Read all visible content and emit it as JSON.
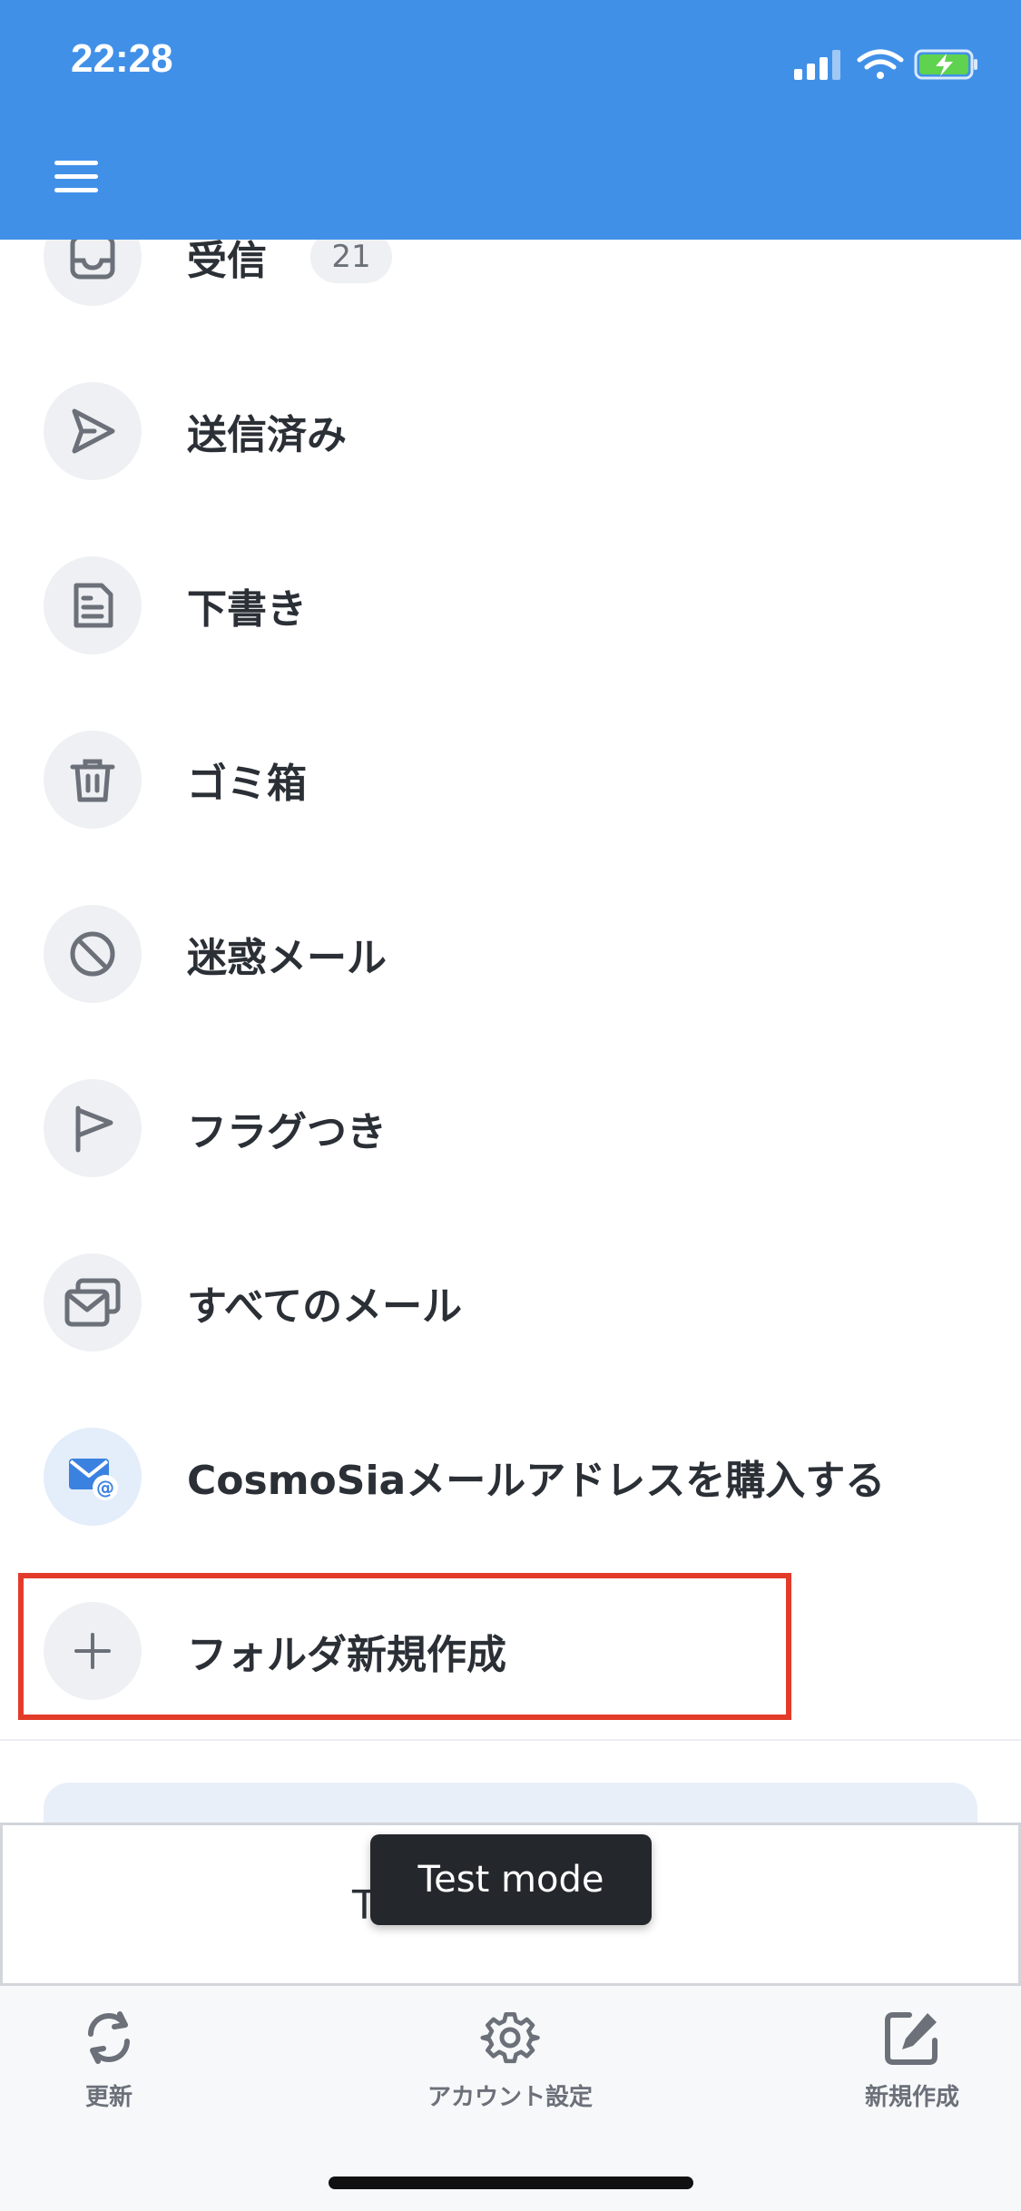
{
  "status_bar": {
    "time": "22:28",
    "icons": [
      "cellular-signal-icon",
      "wifi-icon",
      "battery-charging-icon"
    ],
    "background_color": "#4190e8"
  },
  "header": {
    "menu_icon": "hamburger-menu-icon"
  },
  "folders": [
    {
      "label": "受信",
      "icon": "inbox-icon",
      "badge": "21"
    },
    {
      "label": "送信済み",
      "icon": "send-icon"
    },
    {
      "label": "下書き",
      "icon": "draft-document-icon"
    },
    {
      "label": "ゴミ箱",
      "icon": "trash-icon"
    },
    {
      "label": "迷惑メール",
      "icon": "block-icon"
    },
    {
      "label": "フラグつき",
      "icon": "flag-icon"
    },
    {
      "label": "すべてのメール",
      "icon": "all-mail-icon"
    },
    {
      "label": "CosmoSiaメールアドレスを購入する",
      "icon": "mail-at-icon"
    },
    {
      "label": "フォルダ新規作成",
      "icon": "plus-icon"
    }
  ],
  "highlight_color": "#e33b2a",
  "ad_banner": {
    "partial_text": "T"
  },
  "toast": {
    "text": "Test mode"
  },
  "tabbar": {
    "items": [
      {
        "label": "更新",
        "icon": "refresh-icon"
      },
      {
        "label": "アカウント設定",
        "icon": "gear-icon"
      },
      {
        "label": "新規作成",
        "icon": "compose-icon"
      }
    ]
  }
}
